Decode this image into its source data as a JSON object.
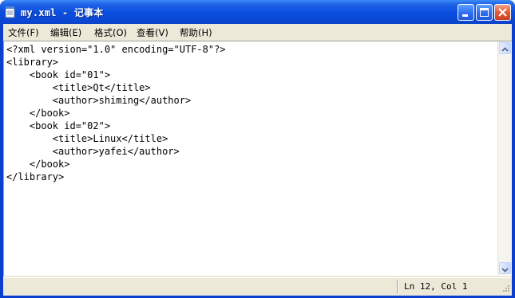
{
  "window": {
    "title": "my.xml - 记事本"
  },
  "menu": {
    "items": [
      "文件(F)",
      "编辑(E)",
      "格式(O)",
      "查看(V)",
      "帮助(H)"
    ]
  },
  "editor": {
    "content": "<?xml version=\"1.0\" encoding=\"UTF-8\"?>\n<library>\n    <book id=\"01\">\n        <title>Qt</title>\n        <author>shiming</author>\n    </book>\n    <book id=\"02\">\n        <title>Linux</title>\n        <author>yafei</author>\n    </book>\n</library>"
  },
  "status": {
    "position": "Ln 12, Col 1"
  },
  "colors": {
    "titlebar": "#0b4fe0",
    "chrome": "#ece9d8",
    "close_button": "#e25a33"
  }
}
